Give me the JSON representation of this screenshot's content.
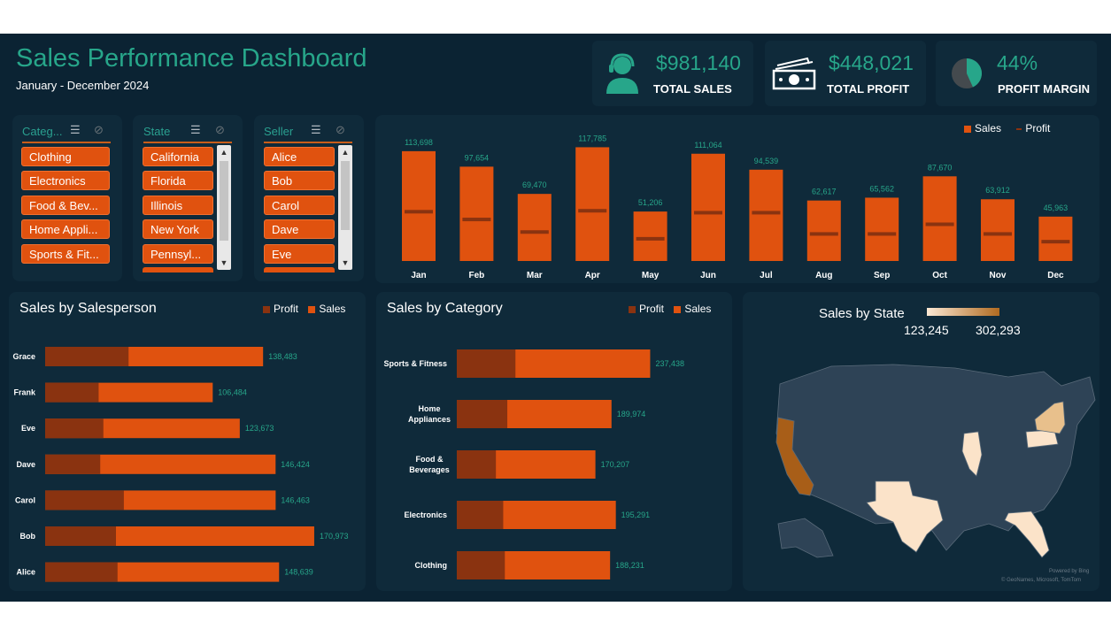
{
  "header": {
    "title": "Sales Performance Dashboard",
    "subtitle": "January - December 2024"
  },
  "kpis": [
    {
      "value": "$981,140",
      "label": "TOTAL SALES",
      "icon": "support-agent-icon"
    },
    {
      "value": "$448,021",
      "label": "TOTAL PROFIT",
      "icon": "cash-icon"
    },
    {
      "value": "44%",
      "label": "PROFIT MARGIN",
      "icon": "pie-icon"
    }
  ],
  "slicers": [
    {
      "title": "Categ...",
      "items": [
        "Clothing",
        "Electronics",
        "Food & Bev...",
        "Home Appli...",
        "Sports & Fit..."
      ]
    },
    {
      "title": "State",
      "items": [
        "California",
        "Florida",
        "Illinois",
        "New York",
        "Pennsyl..."
      ]
    },
    {
      "title": "Seller",
      "items": [
        "Alice",
        "Bob",
        "Carol",
        "Dave",
        "Eve"
      ]
    }
  ],
  "colors": {
    "sales": "#e0520f",
    "profit": "#8a3310",
    "accent": "#27a68a",
    "panel": "#0f2a3a",
    "background": "#0b2333"
  },
  "monthly": {
    "legend": {
      "sales": "Sales",
      "profit": "Profit"
    }
  },
  "salesperson": {
    "title": "Sales by Salesperson",
    "legend": {
      "profit": "Profit",
      "sales": "Sales"
    }
  },
  "category": {
    "title": "Sales by Category",
    "legend": {
      "profit": "Profit",
      "sales": "Sales"
    }
  },
  "state_map": {
    "title": "Sales by State",
    "min_label": "123,245",
    "max_label": "302,293",
    "attribution_1": "Powered by Bing",
    "attribution_2": "© GeoNames, Microsoft, TomTom"
  },
  "chart_data": [
    {
      "type": "bar",
      "categories": [
        "Jan",
        "Feb",
        "Mar",
        "Apr",
        "May",
        "Jun",
        "Jul",
        "Aug",
        "Sep",
        "Oct",
        "Nov",
        "Dec"
      ],
      "series": [
        {
          "name": "Sales",
          "values": [
            113698,
            97654,
            69470,
            117785,
            51206,
            111064,
            94539,
            62617,
            65562,
            87670,
            63912,
            45963
          ]
        },
        {
          "name": "Profit",
          "values": [
            51000,
            43000,
            30000,
            52000,
            23000,
            50000,
            50000,
            28000,
            28000,
            38000,
            28000,
            20000
          ]
        }
      ],
      "ylim": [
        0,
        120000
      ]
    },
    {
      "type": "bar",
      "orientation": "horizontal",
      "title": "Sales by Salesperson",
      "categories": [
        "Grace",
        "Frank",
        "Eve",
        "Dave",
        "Carol",
        "Bob",
        "Alice"
      ],
      "series": [
        {
          "name": "Profit",
          "values": [
            53000,
            34000,
            37000,
            35000,
            50000,
            45000,
            46000
          ]
        },
        {
          "name": "Sales",
          "values": [
            138483,
            106484,
            123673,
            146424,
            146463,
            170973,
            148639
          ]
        }
      ],
      "xlim": [
        0,
        180000
      ]
    },
    {
      "type": "bar",
      "orientation": "horizontal",
      "title": "Sales by Category",
      "categories": [
        "Sports & Fitness",
        "Home Appliances",
        "Food & Beverages",
        "Electronics",
        "Clothing"
      ],
      "series": [
        {
          "name": "Profit",
          "values": [
            72000,
            62000,
            48000,
            57000,
            59000
          ]
        },
        {
          "name": "Sales",
          "values": [
            237438,
            189974,
            170207,
            195291,
            188231
          ]
        }
      ],
      "xlim": [
        0,
        250000
      ]
    }
  ]
}
